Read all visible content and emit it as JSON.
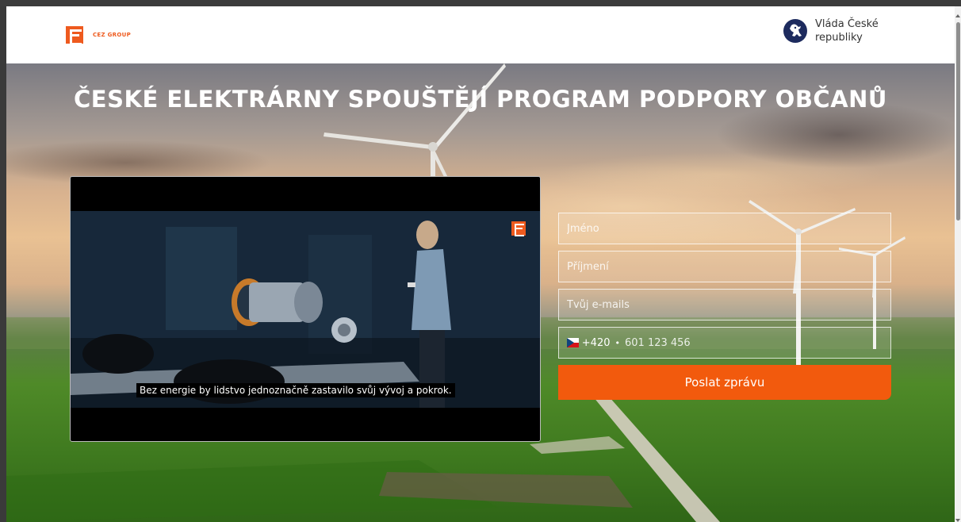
{
  "header": {
    "logo_text": "CEZ GROUP",
    "gov_text": "Vláda České republiky"
  },
  "hero": {
    "headline": "ČESKÉ ELEKTRÁRNY SPOUŠTĚJÍ PROGRAM PODPORY OBČANŮ"
  },
  "video": {
    "subtitle": "Bez energie by lidstvo jednoznačně zastavilo svůj vývoj a pokrok."
  },
  "form": {
    "first_name_placeholder": "Jméno",
    "last_name_placeholder": "Příjmení",
    "email_placeholder": "Tvůj e-mails",
    "phone_prefix": "+420",
    "phone_separator": "•",
    "phone_placeholder": "601 123 456",
    "submit_label": "Poslat zprávu"
  },
  "colors": {
    "brand": "#ee5a1e",
    "submit": "#f25a0d"
  },
  "icons": {
    "logo": "cez-logo-icon",
    "gov": "czech-lion-emblem-icon",
    "flag": "czech-flag-icon"
  }
}
